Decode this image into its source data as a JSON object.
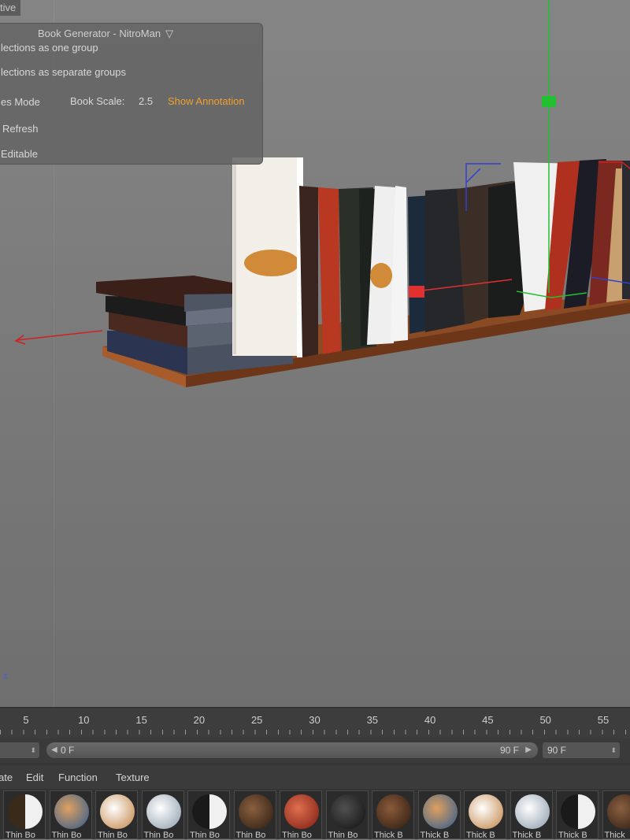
{
  "viewport": {
    "label": "tive",
    "axis_label": "z"
  },
  "plugin": {
    "title": "Book Generator -  NitroMan",
    "items": [
      "lections as one group",
      "lections as separate groups",
      "es Mode",
      "Refresh",
      "Editable"
    ],
    "book_scale_label": "Book Scale:",
    "book_scale_value": "2.5",
    "annotation_link": "Show Annotation"
  },
  "timeline": {
    "ticks": [
      "5",
      "10",
      "15",
      "20",
      "25",
      "30",
      "35",
      "40",
      "45",
      "50",
      "55"
    ],
    "range_start": "0 F",
    "range_end": "90 F",
    "end_frame": "90 F"
  },
  "materials_menu": {
    "items": [
      "ate",
      "Edit",
      "Function",
      "Texture"
    ]
  },
  "materials": [
    {
      "label": "Thin Bo"
    },
    {
      "label": "Thin Bo"
    },
    {
      "label": "Thin Bo"
    },
    {
      "label": "Thin Bo"
    },
    {
      "label": "Thin Bo"
    },
    {
      "label": "Thin Bo"
    },
    {
      "label": "Thin Bo"
    },
    {
      "label": "Thin Bo"
    },
    {
      "label": "Thick B"
    },
    {
      "label": "Thick B"
    },
    {
      "label": "Thick B"
    },
    {
      "label": "Thick B"
    },
    {
      "label": "Thick B"
    },
    {
      "label": "Thick"
    }
  ]
}
